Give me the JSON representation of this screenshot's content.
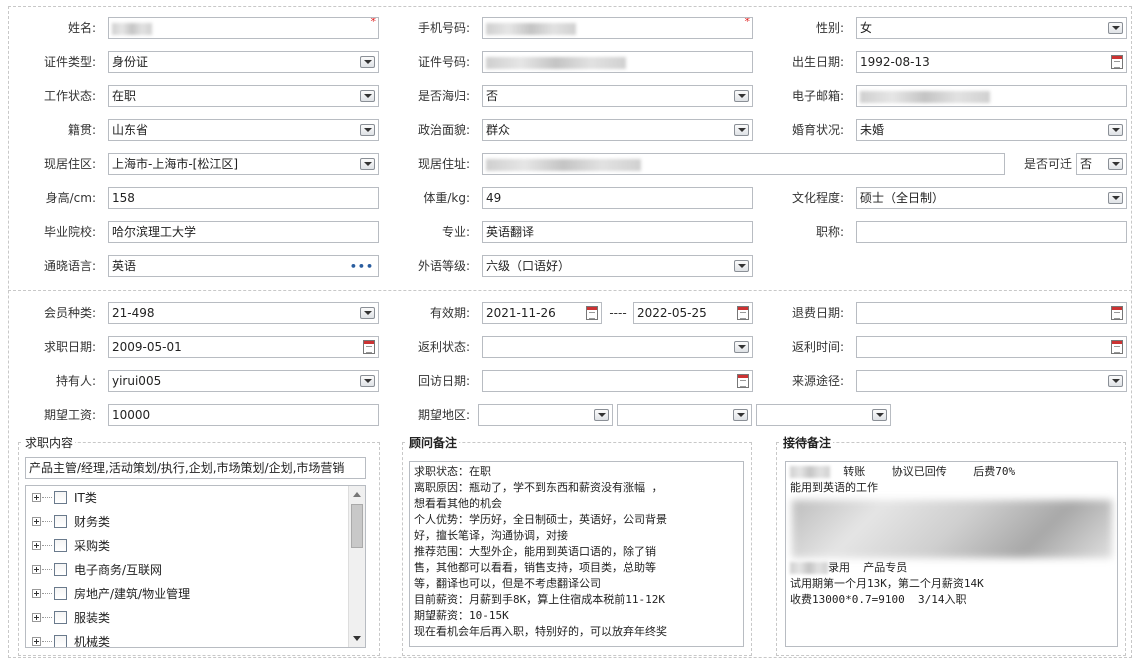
{
  "basic": {
    "name_label": "姓名:",
    "phone_label": "手机号码:",
    "gender_label": "性别:",
    "gender_value": "女",
    "id_type_label": "证件类型:",
    "id_type_value": "身份证",
    "id_no_label": "证件号码:",
    "birth_label": "出生日期:",
    "birth_value": "1992-08-13",
    "work_status_label": "工作状态:",
    "work_status_value": "在职",
    "overseas_label": "是否海归:",
    "overseas_value": "否",
    "email_label": "电子邮箱:",
    "native_label": "籍贯:",
    "native_value": "山东省",
    "political_label": "政治面貌:",
    "political_value": "群众",
    "marital_label": "婚育状况:",
    "marital_value": "未婚",
    "residence_label": "现居住区:",
    "residence_value": "上海市-上海市-[松江区]",
    "address_label": "现居住址:",
    "relocate_label": "是否可迁",
    "relocate_value": "否",
    "height_label": "身高/cm:",
    "height_value": "158",
    "weight_label": "体重/kg:",
    "weight_value": "49",
    "education_label": "文化程度:",
    "education_value": "硕士（全日制）",
    "school_label": "毕业院校:",
    "school_value": "哈尔滨理工大学",
    "major_label": "专业:",
    "major_value": "英语翻译",
    "title_label": "职称:",
    "title_value": "",
    "language_label": "通晓语言:",
    "language_value": "英语",
    "lang_level_label": "外语等级:",
    "lang_level_value": "六级（口语好）"
  },
  "member": {
    "type_label": "会员种类:",
    "type_value": "21-498",
    "valid_label": "有效期:",
    "valid_from": "2021-11-26",
    "valid_sep": "----",
    "valid_to": "2022-05-25",
    "refund_label": "退费日期:",
    "job_date_label": "求职日期:",
    "job_date_value": "2009-05-01",
    "rebate_status_label": "返利状态:",
    "rebate_time_label": "返利时间:",
    "holder_label": "持有人:",
    "holder_value": "yirui005",
    "visit_label": "回访日期:",
    "source_label": "来源途径:",
    "salary_label": "期望工资:",
    "salary_value": "10000",
    "region_label": "期望地区:"
  },
  "job_panel": {
    "title": "求职内容",
    "summary": "产品主管/经理,活动策划/执行,企划,市场策划/企划,市场营销",
    "tree": [
      "IT类",
      "财务类",
      "采购类",
      "电子商务/互联网",
      "房地产/建筑/物业管理",
      "服装类",
      "机械类"
    ]
  },
  "advisor_panel": {
    "title": "顾问备注",
    "lines": [
      "求职状态：在职",
      "离职原因：瓶动了，学不到东西和薪资没有涨幅 ，",
      "想看看其他的机会",
      "个人优势：学历好，全日制硕士，英语好，公司背景",
      "好，擅长笔译，沟通协调，对接",
      "推荐范围：大型外企，能用到英语口语的，除了销",
      "售，其他都可以看看，销售支持，项目类，总助等",
      "等，翻译也可以，但是不考虑翻译公司",
      "目前薪资：月薪到手8K，算上住宿成本税前11-12K",
      "期望薪资：10-15K",
      "现在看机会年后再入职，特别好的，可以放弃年终奖"
    ]
  },
  "reception_panel": {
    "title": "接待备注",
    "line1": "转账    协议已回传    后费70%",
    "line2": "能用到英语的工作",
    "line3": "录用  产品专员",
    "line4": "试用期第一个月13K，第二个月薪资14K",
    "line5": "收费13000*0.7=9100  3/14入职"
  }
}
